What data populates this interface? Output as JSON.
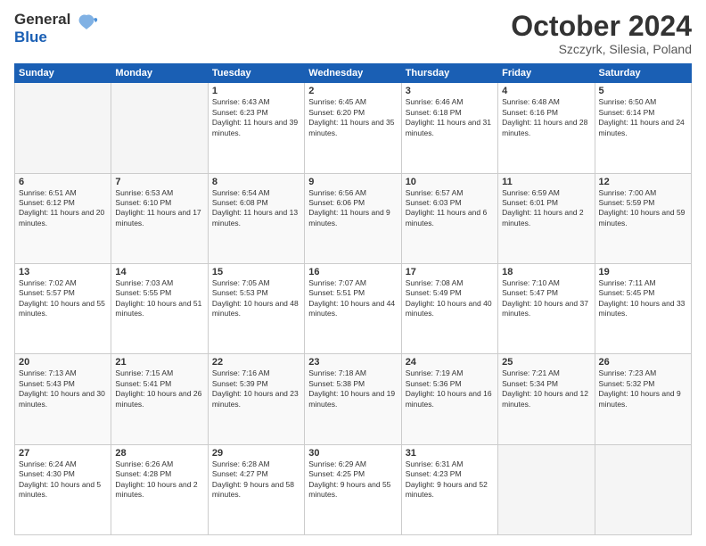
{
  "header": {
    "logo_general": "General",
    "logo_blue": "Blue",
    "month": "October 2024",
    "location": "Szczyrk, Silesia, Poland"
  },
  "weekdays": [
    "Sunday",
    "Monday",
    "Tuesday",
    "Wednesday",
    "Thursday",
    "Friday",
    "Saturday"
  ],
  "weeks": [
    [
      {
        "day": "",
        "info": ""
      },
      {
        "day": "",
        "info": ""
      },
      {
        "day": "1",
        "info": "Sunrise: 6:43 AM\nSunset: 6:23 PM\nDaylight: 11 hours and 39 minutes."
      },
      {
        "day": "2",
        "info": "Sunrise: 6:45 AM\nSunset: 6:20 PM\nDaylight: 11 hours and 35 minutes."
      },
      {
        "day": "3",
        "info": "Sunrise: 6:46 AM\nSunset: 6:18 PM\nDaylight: 11 hours and 31 minutes."
      },
      {
        "day": "4",
        "info": "Sunrise: 6:48 AM\nSunset: 6:16 PM\nDaylight: 11 hours and 28 minutes."
      },
      {
        "day": "5",
        "info": "Sunrise: 6:50 AM\nSunset: 6:14 PM\nDaylight: 11 hours and 24 minutes."
      }
    ],
    [
      {
        "day": "6",
        "info": "Sunrise: 6:51 AM\nSunset: 6:12 PM\nDaylight: 11 hours and 20 minutes."
      },
      {
        "day": "7",
        "info": "Sunrise: 6:53 AM\nSunset: 6:10 PM\nDaylight: 11 hours and 17 minutes."
      },
      {
        "day": "8",
        "info": "Sunrise: 6:54 AM\nSunset: 6:08 PM\nDaylight: 11 hours and 13 minutes."
      },
      {
        "day": "9",
        "info": "Sunrise: 6:56 AM\nSunset: 6:06 PM\nDaylight: 11 hours and 9 minutes."
      },
      {
        "day": "10",
        "info": "Sunrise: 6:57 AM\nSunset: 6:03 PM\nDaylight: 11 hours and 6 minutes."
      },
      {
        "day": "11",
        "info": "Sunrise: 6:59 AM\nSunset: 6:01 PM\nDaylight: 11 hours and 2 minutes."
      },
      {
        "day": "12",
        "info": "Sunrise: 7:00 AM\nSunset: 5:59 PM\nDaylight: 10 hours and 59 minutes."
      }
    ],
    [
      {
        "day": "13",
        "info": "Sunrise: 7:02 AM\nSunset: 5:57 PM\nDaylight: 10 hours and 55 minutes."
      },
      {
        "day": "14",
        "info": "Sunrise: 7:03 AM\nSunset: 5:55 PM\nDaylight: 10 hours and 51 minutes."
      },
      {
        "day": "15",
        "info": "Sunrise: 7:05 AM\nSunset: 5:53 PM\nDaylight: 10 hours and 48 minutes."
      },
      {
        "day": "16",
        "info": "Sunrise: 7:07 AM\nSunset: 5:51 PM\nDaylight: 10 hours and 44 minutes."
      },
      {
        "day": "17",
        "info": "Sunrise: 7:08 AM\nSunset: 5:49 PM\nDaylight: 10 hours and 40 minutes."
      },
      {
        "day": "18",
        "info": "Sunrise: 7:10 AM\nSunset: 5:47 PM\nDaylight: 10 hours and 37 minutes."
      },
      {
        "day": "19",
        "info": "Sunrise: 7:11 AM\nSunset: 5:45 PM\nDaylight: 10 hours and 33 minutes."
      }
    ],
    [
      {
        "day": "20",
        "info": "Sunrise: 7:13 AM\nSunset: 5:43 PM\nDaylight: 10 hours and 30 minutes."
      },
      {
        "day": "21",
        "info": "Sunrise: 7:15 AM\nSunset: 5:41 PM\nDaylight: 10 hours and 26 minutes."
      },
      {
        "day": "22",
        "info": "Sunrise: 7:16 AM\nSunset: 5:39 PM\nDaylight: 10 hours and 23 minutes."
      },
      {
        "day": "23",
        "info": "Sunrise: 7:18 AM\nSunset: 5:38 PM\nDaylight: 10 hours and 19 minutes."
      },
      {
        "day": "24",
        "info": "Sunrise: 7:19 AM\nSunset: 5:36 PM\nDaylight: 10 hours and 16 minutes."
      },
      {
        "day": "25",
        "info": "Sunrise: 7:21 AM\nSunset: 5:34 PM\nDaylight: 10 hours and 12 minutes."
      },
      {
        "day": "26",
        "info": "Sunrise: 7:23 AM\nSunset: 5:32 PM\nDaylight: 10 hours and 9 minutes."
      }
    ],
    [
      {
        "day": "27",
        "info": "Sunrise: 6:24 AM\nSunset: 4:30 PM\nDaylight: 10 hours and 5 minutes."
      },
      {
        "day": "28",
        "info": "Sunrise: 6:26 AM\nSunset: 4:28 PM\nDaylight: 10 hours and 2 minutes."
      },
      {
        "day": "29",
        "info": "Sunrise: 6:28 AM\nSunset: 4:27 PM\nDaylight: 9 hours and 58 minutes."
      },
      {
        "day": "30",
        "info": "Sunrise: 6:29 AM\nSunset: 4:25 PM\nDaylight: 9 hours and 55 minutes."
      },
      {
        "day": "31",
        "info": "Sunrise: 6:31 AM\nSunset: 4:23 PM\nDaylight: 9 hours and 52 minutes."
      },
      {
        "day": "",
        "info": ""
      },
      {
        "day": "",
        "info": ""
      }
    ]
  ]
}
